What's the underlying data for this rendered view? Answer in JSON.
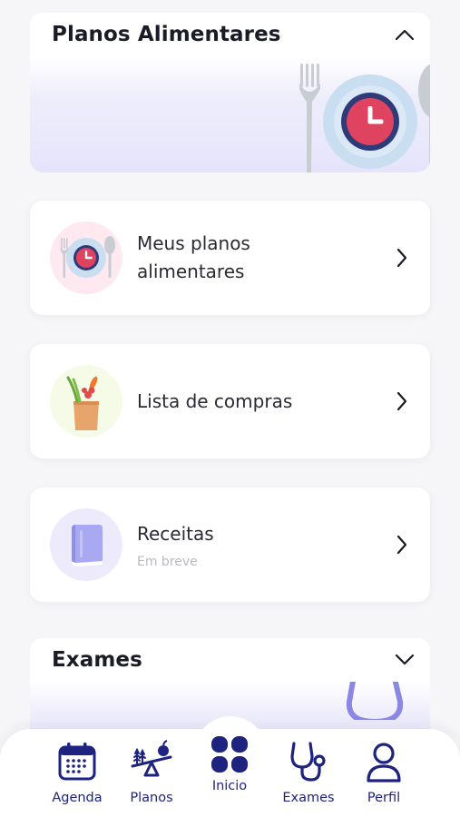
{
  "planos_section": {
    "title": "Planos Alimentares",
    "toggle_icon": "chevron-up-icon",
    "illustration": "plate-clock-cutlery-illustration"
  },
  "menu": [
    {
      "label_line1": "Meus planos",
      "label_line2": "alimentares",
      "subtitle": "",
      "icon": "plate-clock-icon",
      "thumb_color": "#fde9ef"
    },
    {
      "label_line1": "Lista de compras",
      "label_line2": "",
      "subtitle": "",
      "icon": "grocery-bag-icon",
      "thumb_color": "#f5fbe6"
    },
    {
      "label_line1": "Receitas",
      "label_line2": "",
      "subtitle": "Em breve",
      "icon": "recipe-book-icon",
      "thumb_color": "#eceafb"
    }
  ],
  "exames_section": {
    "title": "Exames",
    "toggle_icon": "chevron-down-icon",
    "illustration": "stethoscope-illustration"
  },
  "nav": {
    "items": [
      {
        "label": "Agenda",
        "icon": "calendar-icon"
      },
      {
        "label": "Planos",
        "icon": "scale-apple-icon"
      },
      {
        "label": "Inicio",
        "icon": "grid-home-icon"
      },
      {
        "label": "Exames",
        "icon": "stethoscope-icon"
      },
      {
        "label": "Perfil",
        "icon": "user-icon"
      }
    ]
  },
  "colors": {
    "primary": "#1f2380",
    "banner": "#e6e4fb",
    "clock_red": "#e0435f",
    "clock_ring": "#2f3b78",
    "plate": "#c9def0"
  }
}
